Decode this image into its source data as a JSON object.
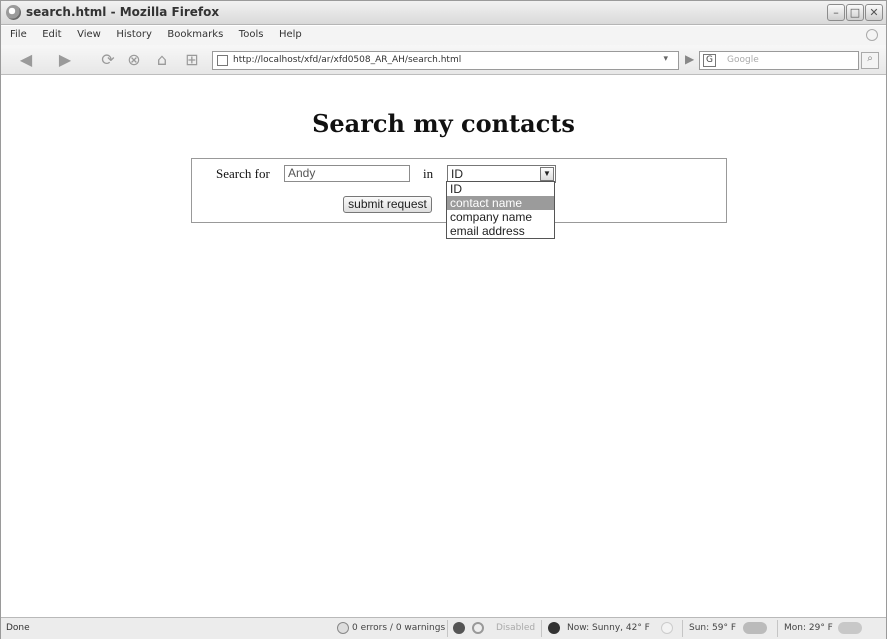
{
  "window": {
    "title": "search.html - Mozilla Firefox"
  },
  "window_controls": {
    "minimize": "–",
    "maximize": "□",
    "close": "✕"
  },
  "menu": [
    {
      "label": "File"
    },
    {
      "label": "Edit"
    },
    {
      "label": "View"
    },
    {
      "label": "History"
    },
    {
      "label": "Bookmarks"
    },
    {
      "label": "Tools"
    },
    {
      "label": "Help"
    }
  ],
  "toolbar": {
    "back_icon": "◀",
    "forward_icon": "▶",
    "reload_icon": "⟳",
    "stop_icon": "⊗",
    "home_icon": "⌂",
    "newtab_icon": "⊞",
    "go_icon": "▶",
    "dropmarker": "▾",
    "search_engine_letter": "G",
    "search_button_icon": "🔍"
  },
  "address_bar": {
    "url": "http://localhost/xfd/ar/xfd0508_AR_AH/search.html"
  },
  "search_bar": {
    "placeholder": "Google"
  },
  "page": {
    "title": "Search my contacts",
    "form": {
      "search_label": "Search for",
      "search_value": "Andy",
      "in_label": "in",
      "select_value": "ID",
      "select_arrow": "▼",
      "submit_label": "submit request",
      "dropdown_options": [
        "ID",
        "contact name",
        "company name",
        "email address"
      ],
      "highlighted_option": "contact name"
    }
  },
  "statusbar": {
    "status": "Done",
    "errors": "0 errors / 0 warnings",
    "disabled": "Disabled",
    "weather_now": "Now: Sunny, 42° F",
    "weather_sun": "Sun: 59° F",
    "weather_mon": "Mon: 29° F"
  },
  "colors": {
    "highlight": "#9b9b9b",
    "chrome": "#e7e7e7"
  }
}
